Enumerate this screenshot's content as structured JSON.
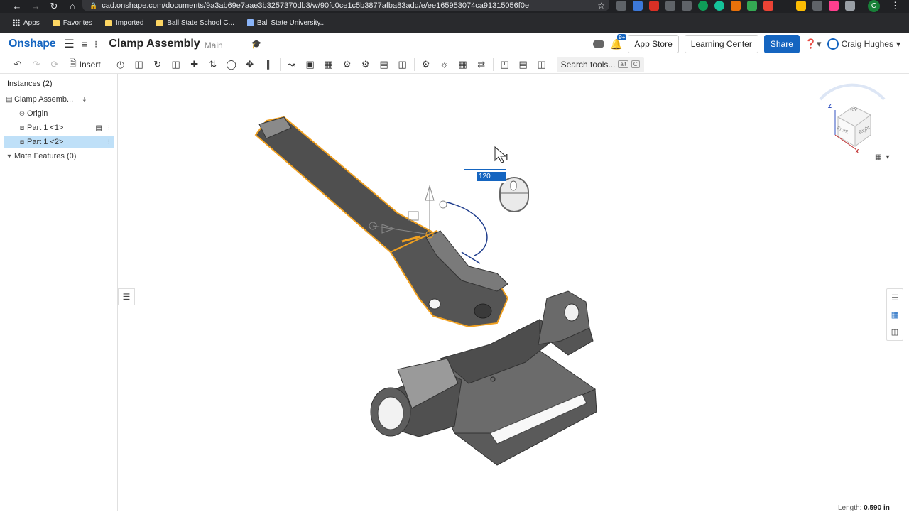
{
  "browser": {
    "url": "cad.onshape.com/documents/9a3ab69e7aae3b3257370db3/w/90fc0ce1c5b3877afba83add/e/ee165953074ca91315056f0e",
    "profile_initial": "C",
    "bookmarks": [
      {
        "label": "Apps",
        "icon": "apps-grid-icon"
      },
      {
        "label": "Favorites",
        "icon": "folder-icon"
      },
      {
        "label": "Imported",
        "icon": "folder-icon"
      },
      {
        "label": "Ball State School C...",
        "icon": "folder-icon"
      },
      {
        "label": "Ball State University...",
        "icon": "page-icon"
      }
    ]
  },
  "header": {
    "logo": "Onshape",
    "doc_title": "Clamp Assembly",
    "branch": "Main",
    "notification_badge": "9+",
    "app_store": "App Store",
    "learning_center": "Learning Center",
    "share": "Share",
    "user_name": "Craig Hughes"
  },
  "toolbar": {
    "insert_label": "Insert",
    "search_tools": "Search tools...",
    "shortcut_alt": "alt",
    "shortcut_key": "C"
  },
  "panel": {
    "title": "Instances (2)",
    "items": [
      {
        "label": "Clamp Assemb..."
      },
      {
        "label": "Origin"
      },
      {
        "label": "Part 1 <1>"
      },
      {
        "label": "Part 1 <2>"
      },
      {
        "label": "Mate Features (0)"
      }
    ]
  },
  "viewport": {
    "angle_input": "120 deg",
    "cursor_subscript": "1",
    "view_cube": {
      "z": "Z",
      "x": "X",
      "top": "Top",
      "front": "Front",
      "right": "Right"
    },
    "status_label": "Length:",
    "status_value": "0.590 in"
  },
  "colors": {
    "accent": "#1565c0",
    "selection": "#f0a020",
    "part_dark": "#4a4a4a",
    "tree_selected": "#bfe0f8"
  }
}
